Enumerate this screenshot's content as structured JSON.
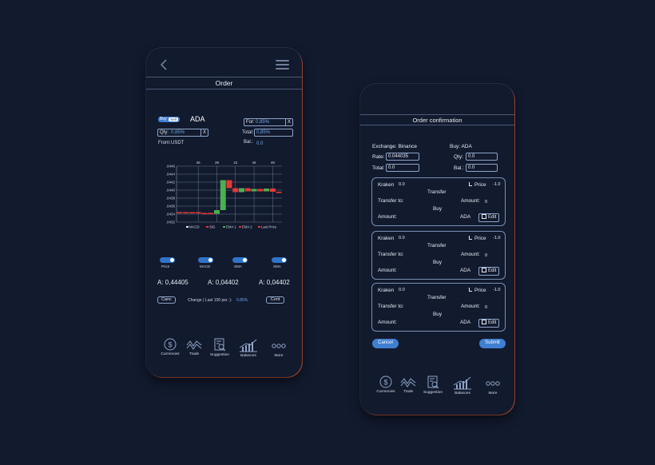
{
  "colors": {
    "background": "#121a2e",
    "accent": "#3f7fd1",
    "border": "#8ea4c8",
    "orange_edge": "#c65a3a",
    "candle_up": "#4caf50",
    "candle_down": "#e53935"
  },
  "order": {
    "title": "Order",
    "buy_label": "Buy",
    "sell_label": "Sell",
    "asset": "ADA",
    "for_label": "For:",
    "for_value": "0,85%",
    "qty_label": "Qty:",
    "qty_value": "0,85%",
    "total_label": "Total:",
    "total_value": "0,85%",
    "from_label": "From:",
    "from_value": "USDT",
    "bal_label": "Bal.:",
    "bal_value": "0.0",
    "clear_x": "X",
    "toggles": [
      "Price",
      "MACD",
      "SMA",
      "SMA"
    ],
    "prices": [
      "A: 0,44405",
      "A: 0,04402",
      "A: 0,04402"
    ],
    "canc_label": "Canc",
    "change_label": "Change ( Last 100 per. ):",
    "change_value": "0.85%",
    "cont_label": "Cont"
  },
  "chart_data": {
    "type": "candlestick",
    "x_ticks": [
      "36",
      "39",
      "42",
      "45",
      "48"
    ],
    "y_ticks": [
      ".0446",
      ".0444",
      ".0442",
      ".0440",
      ".0438",
      ".0436",
      ".0434",
      ".0432"
    ],
    "ylim": [
      0.0432,
      0.0446
    ],
    "candles": [
      {
        "x": 33.5,
        "open": 0.04345,
        "close": 0.04345
      },
      {
        "x": 34.5,
        "open": 0.04345,
        "close": 0.04345
      },
      {
        "x": 35.5,
        "open": 0.04345,
        "close": 0.04345
      },
      {
        "x": 36.5,
        "open": 0.04345,
        "close": 0.04343
      },
      {
        "x": 37.5,
        "open": 0.04343,
        "close": 0.04343
      },
      {
        "x": 38.5,
        "open": 0.04343,
        "close": 0.04341
      },
      {
        "x": 39.5,
        "open": 0.04341,
        "close": 0.0435
      },
      {
        "x": 40.5,
        "open": 0.0435,
        "close": 0.04425
      },
      {
        "x": 41.5,
        "open": 0.04425,
        "close": 0.04405
      },
      {
        "x": 42.5,
        "open": 0.04405,
        "close": 0.04395
      },
      {
        "x": 43.5,
        "open": 0.04395,
        "close": 0.04405
      },
      {
        "x": 44.5,
        "open": 0.04405,
        "close": 0.04397
      },
      {
        "x": 45.5,
        "open": 0.04397,
        "close": 0.04403
      },
      {
        "x": 46.5,
        "open": 0.04403,
        "close": 0.04397
      },
      {
        "x": 47.5,
        "open": 0.04397,
        "close": 0.04404
      },
      {
        "x": 48.5,
        "open": 0.04404,
        "close": 0.04396
      },
      {
        "x": 49.5,
        "open": 0.04396,
        "close": 0.04396
      }
    ],
    "legend": [
      "MACD",
      "SIG",
      "EMA 1",
      "EMA 2",
      "Last Price"
    ],
    "legend_colors": [
      "#e6ecf5",
      "#e53935",
      "#4caf50",
      "#e53935",
      "#e53935"
    ],
    "grid": true
  },
  "confirm": {
    "title": "Order confirmation",
    "exchange": "Exchange: Binance",
    "buy_asset": "Buy: ADA",
    "rate_label": "Rate:",
    "rate_value": "0.044035",
    "qty_label": "Qty:",
    "qty_value": "0.0",
    "total_label": "Total:",
    "total_value": "0.0",
    "bal_label": "Bal.:",
    "bal_value": "0.0",
    "cards": [
      {
        "exchange": "Kraken",
        "exchange_value": "0.0",
        "price_label": "Price",
        "price_value": "-1.0",
        "transfer": "Transfer",
        "transfer_to": "Transfer to:",
        "amount_label": "Amount:",
        "amount_value": "0",
        "amount_label2": "Amount:",
        "buy": "Buy",
        "asset": "ADA",
        "edit": "Edit"
      },
      {
        "exchange": "Kraken",
        "exchange_value": "0.0",
        "price_label": "Price",
        "price_value": "-1.0",
        "transfer": "Transfer",
        "transfer_to": "Transfer to:",
        "amount_label": "Amount:",
        "amount_value": "0",
        "amount_label2": "Amount:",
        "buy": "Buy",
        "asset": "ADA",
        "edit": "Edit"
      },
      {
        "exchange": "Kraken",
        "exchange_value": "0.0",
        "price_label": "Price",
        "price_value": "-1.0",
        "transfer": "Transfer",
        "transfer_to": "Transfer to:",
        "amount_label": "Amount:",
        "amount_value": "0",
        "amount_label2": "Amount:",
        "buy": "Buy",
        "asset": "ADA",
        "edit": "Edit"
      }
    ],
    "cancel_label": "Cancel",
    "submit_label": "Submit"
  },
  "nav": [
    {
      "label": "Currencies",
      "icon": "dollar-coin-icon"
    },
    {
      "label": "Trade",
      "icon": "trade-waves-icon"
    },
    {
      "label": "Suggestion",
      "icon": "suggestion-doc-icon"
    },
    {
      "label": "Balances",
      "icon": "balances-chart-icon"
    },
    {
      "label": "More",
      "icon": "more-dots-icon"
    }
  ]
}
